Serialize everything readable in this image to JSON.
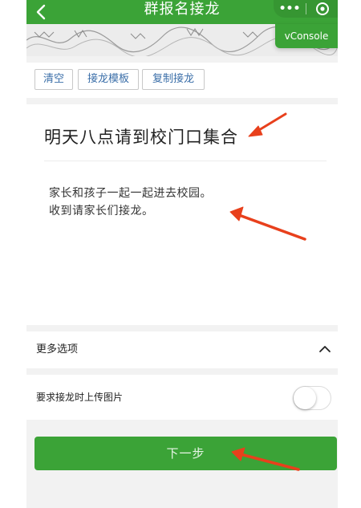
{
  "header": {
    "back_icon": "chevron-left-icon",
    "title": "群报名接龙",
    "more_icon": "more-dots-icon",
    "more_glyph": "•••",
    "close_icon": "target-circle-icon",
    "accent": "#3ba337"
  },
  "debug": {
    "vconsole_label": "vConsole"
  },
  "toolbar": {
    "clear_label": "清空",
    "template_label": "接龙模板",
    "copy_label": "复制接龙"
  },
  "content": {
    "title": "明天八点请到校门口集合",
    "body_lines": [
      "家长和孩子一起一起进去校园。",
      "收到请家长们接龙。"
    ]
  },
  "options": {
    "more_label": "更多选项",
    "more_expanded": true,
    "upload_label": "要求接龙时上传图片",
    "upload_enabled": false
  },
  "actions": {
    "next_label": "下一步"
  },
  "annotations": {
    "arrow_color": "#e8401c"
  }
}
